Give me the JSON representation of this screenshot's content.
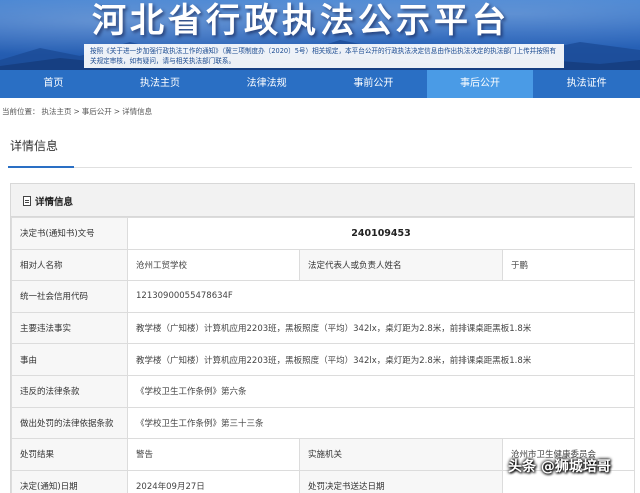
{
  "banner": {
    "title": "河北省行政执法公示平台",
    "notice": "按照《关于进一步加强行政执法工作的通知》（冀三项制度办〔2020〕5号）相关规定，本平台公开的行政执法决定信息由作出执法决定的执法部门上传并按照有关规定审核，如有疑问，请与相关执法部门联系。"
  },
  "nav": {
    "items": [
      {
        "label": "首页"
      },
      {
        "label": "执法主页"
      },
      {
        "label": "法律法规"
      },
      {
        "label": "事前公开"
      },
      {
        "label": "事后公开"
      },
      {
        "label": "执法证件"
      }
    ]
  },
  "breadcrumb": {
    "prefix": "当前位置：",
    "items": [
      "执法主页",
      "事后公开",
      "详情信息"
    ],
    "separator": ">"
  },
  "panel": {
    "title": "详情信息"
  },
  "detail": {
    "header": "详情信息",
    "doc_no_label": "决定书(通知书)文号",
    "doc_no": "240109453",
    "rows": {
      "party_label": "相对人名称",
      "party": "沧州工贸学校",
      "legal_rep_label": "法定代表人或负责人姓名",
      "legal_rep": "于鹏",
      "credit_code_label": "统一社会信用代码",
      "credit_code": "12130900055478634F",
      "facts_label": "主要违法事实",
      "facts": "教学楼（广知楼）计算机应用2203班，黑板照度（平均）342lx，桌灯距为2.8米，前排课桌距黑板1.8米",
      "reason_label": "事由",
      "reason": "教学楼（广知楼）计算机应用2203班，黑板照度（平均）342lx，桌灯距为2.8米，前排课桌距黑板1.8米",
      "violated_label": "违反的法律条款",
      "violated": "《学校卫生工作条例》第六条",
      "basis_label": "做出处罚的法律依据条款",
      "basis": "《学校卫生工作条例》第三十三条",
      "result_label": "处罚结果",
      "result": "警告",
      "agency_label": "实施机关",
      "agency": "沧州市卫生健康委员会",
      "date_label": "决定(通知)日期",
      "date": "2024年09月27日",
      "delivery_label": "处罚决定书送达日期",
      "delivery": ""
    }
  },
  "watermark": "头条 @狮城培哥"
}
